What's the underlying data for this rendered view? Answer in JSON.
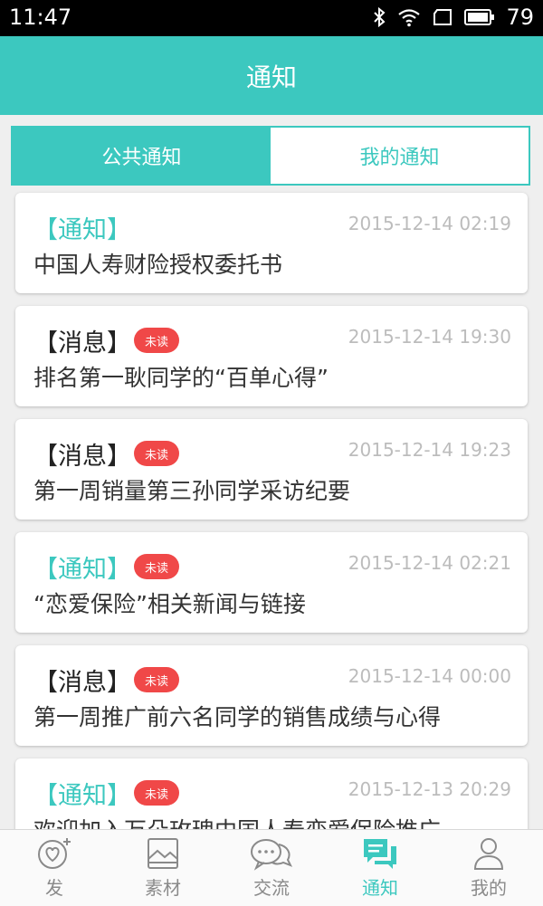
{
  "status_bar": {
    "time": "11:47",
    "battery": "79"
  },
  "header": {
    "title": "通知"
  },
  "tabs": [
    {
      "label": "公共通知",
      "active": true
    },
    {
      "label": "我的通知",
      "active": false
    }
  ],
  "cards": [
    {
      "type": "【通知】",
      "kind": "tz",
      "unread": false,
      "badge": "",
      "time": "2015-12-14 02:19",
      "title": "中国人寿财险授权委托书"
    },
    {
      "type": "【消息】",
      "kind": "xx",
      "unread": true,
      "badge": "未读",
      "time": "2015-12-14 19:30",
      "title": "排名第一耿同学的“百单心得”"
    },
    {
      "type": "【消息】",
      "kind": "xx",
      "unread": true,
      "badge": "未读",
      "time": "2015-12-14 19:23",
      "title": "第一周销量第三孙同学采访纪要"
    },
    {
      "type": "【通知】",
      "kind": "tz",
      "unread": true,
      "badge": "未读",
      "time": "2015-12-14 02:21",
      "title": "“恋爱保险”相关新闻与链接"
    },
    {
      "type": "【消息】",
      "kind": "xx",
      "unread": true,
      "badge": "未读",
      "time": "2015-12-14 00:00",
      "title": "第一周推广前六名同学的销售成绩与心得"
    },
    {
      "type": "【通知】",
      "kind": "tz",
      "unread": true,
      "badge": "未读",
      "time": "2015-12-13 20:29",
      "title": "欢迎加入万朵玫瑰中国人寿恋爱保险推广"
    }
  ],
  "bottom_nav": [
    {
      "label": "发",
      "icon": "heart-add-icon",
      "active": false
    },
    {
      "label": "素材",
      "icon": "picture-icon",
      "active": false
    },
    {
      "label": "交流",
      "icon": "chat-bubbles-icon",
      "active": false
    },
    {
      "label": "通知",
      "icon": "notification-chat-icon",
      "active": true
    },
    {
      "label": "我的",
      "icon": "person-icon",
      "active": false
    }
  ],
  "colors": {
    "primary": "#3cc8bf",
    "badge": "#f04848",
    "background": "#efefef"
  }
}
